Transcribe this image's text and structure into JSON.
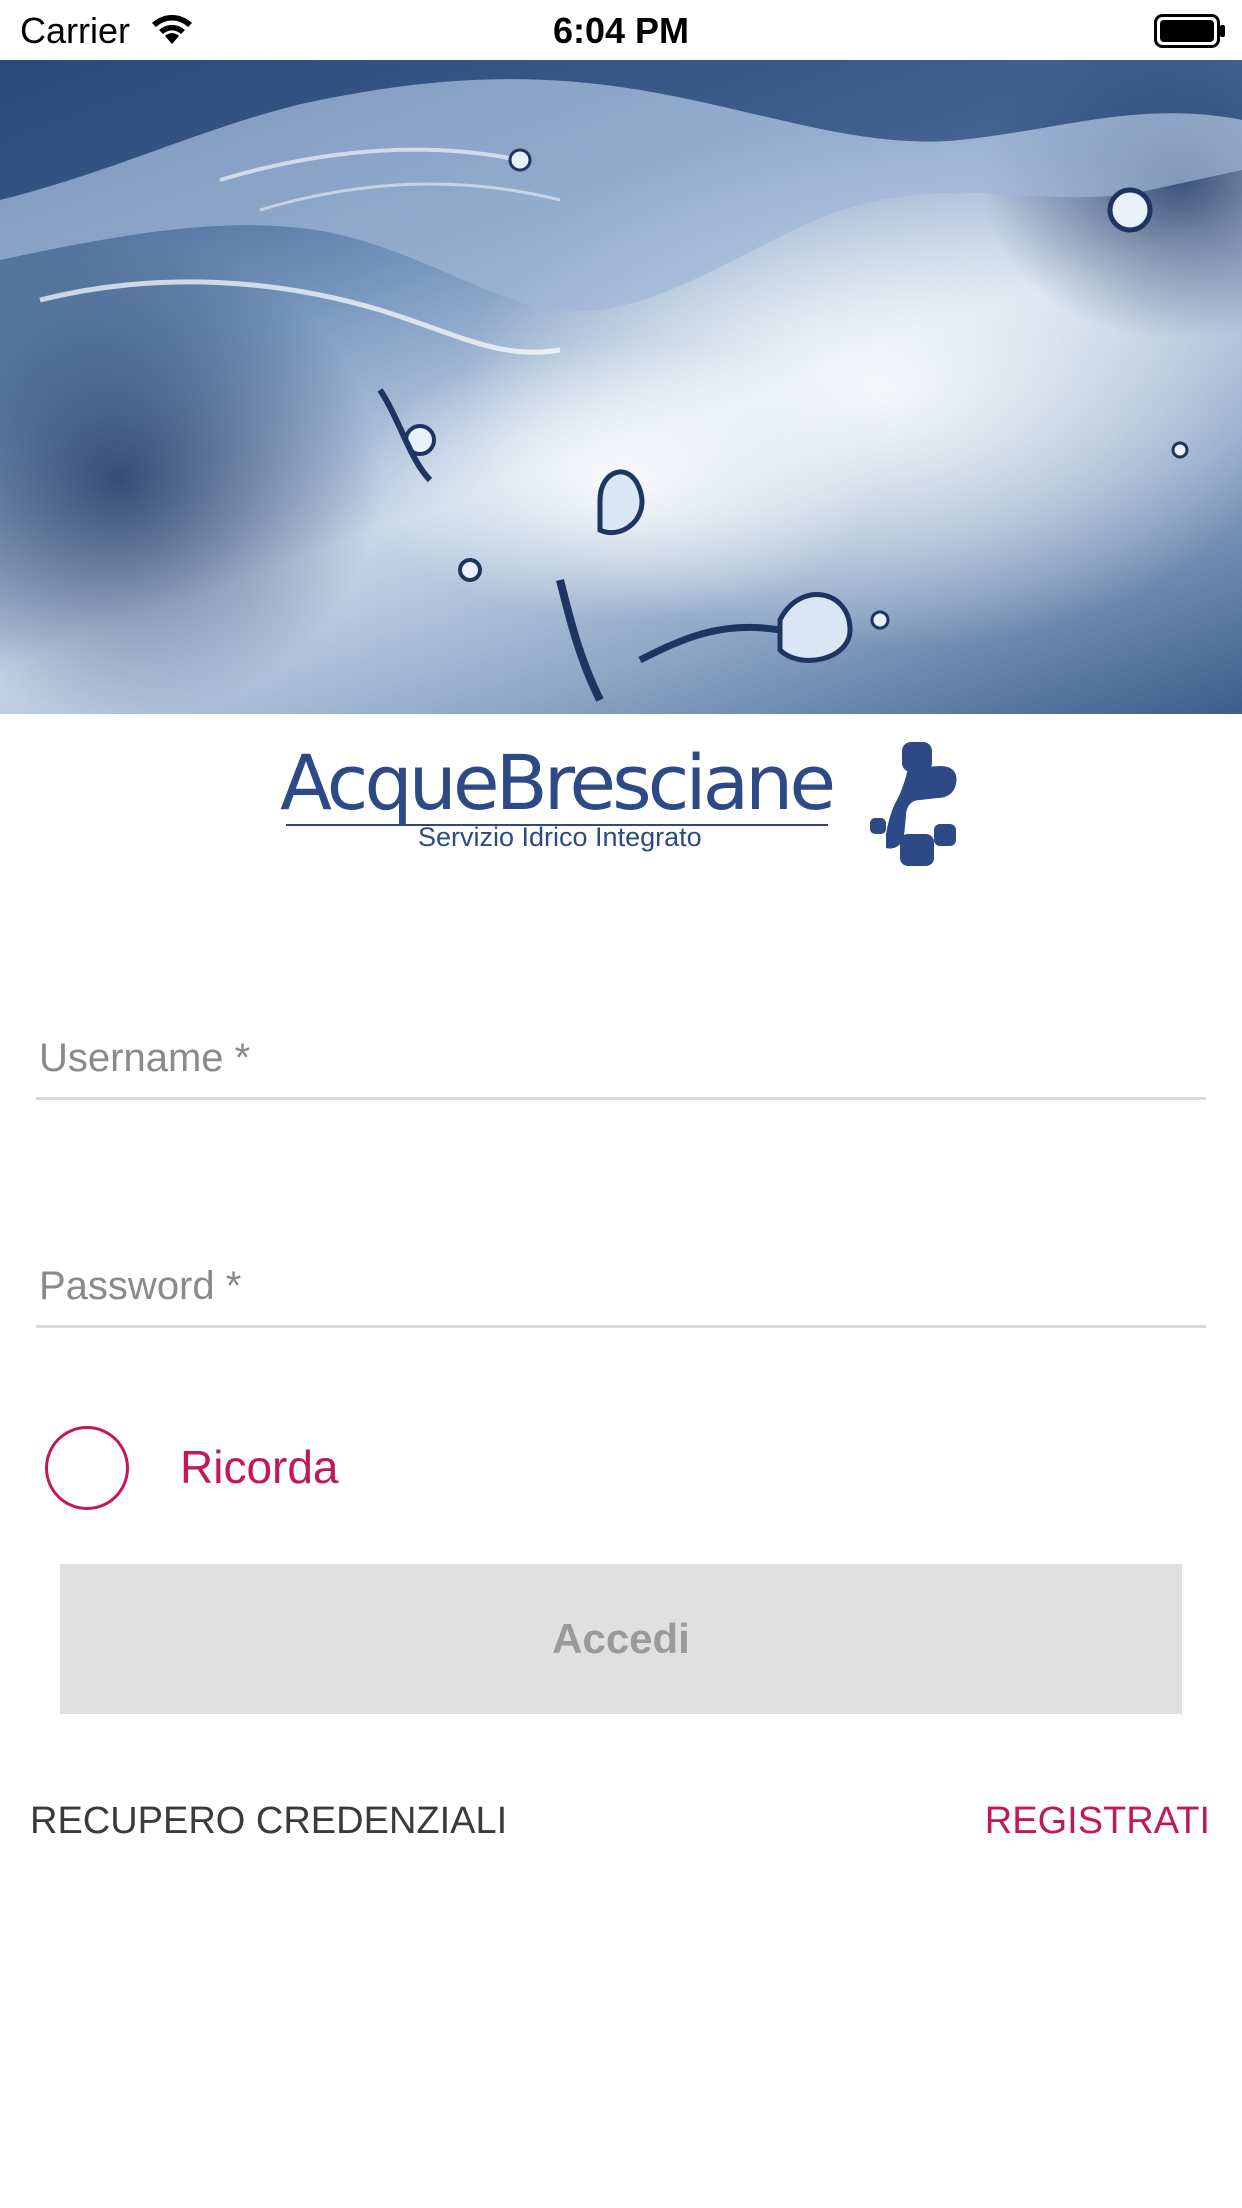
{
  "status_bar": {
    "carrier": "Carrier",
    "time": "6:04 PM",
    "wifi_icon": "wifi-icon",
    "battery_icon": "battery-icon"
  },
  "hero": {
    "image": "water-splash-image"
  },
  "logo": {
    "name": "AcqueBresciane",
    "tagline": "Servizio Idrico Integrato",
    "color": "#2e4a86"
  },
  "form": {
    "username_placeholder": "Username *",
    "password_placeholder": "Password *",
    "remember_label": "Ricorda",
    "login_label": "Accedi"
  },
  "links": {
    "recover": "RECUPERO CREDENZIALI",
    "register": "REGISTRATI"
  },
  "colors": {
    "accent": "#c2185b",
    "button_bg": "#e0e0e0",
    "button_text": "#9a9a9a"
  }
}
